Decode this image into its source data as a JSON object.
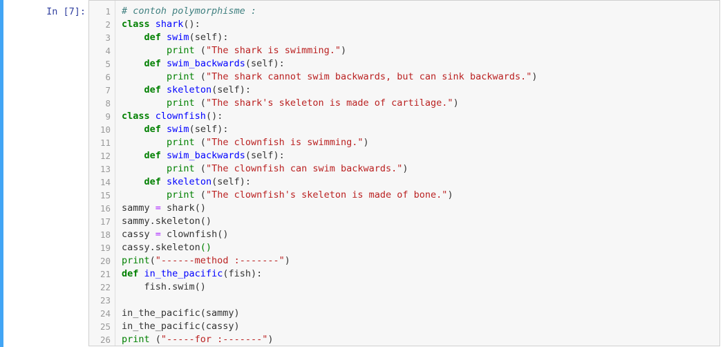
{
  "prompt": "In [7]:",
  "colors": {
    "cell_bar": "#42a5f5",
    "prompt": "#303f9f",
    "keyword": "#008000",
    "function_name": "#0000ff",
    "string": "#ba2121",
    "comment": "#408080",
    "operator": "#aa22ff"
  },
  "code_lines": [
    {
      "num": "1",
      "tokens": [
        {
          "t": "c",
          "v": "# contoh polymorphisme :"
        }
      ]
    },
    {
      "num": "2",
      "tokens": [
        {
          "t": "k",
          "v": "class"
        },
        {
          "t": "p",
          "v": " "
        },
        {
          "t": "nc",
          "v": "shark"
        },
        {
          "t": "p",
          "v": "():"
        }
      ]
    },
    {
      "num": "3",
      "tokens": [
        {
          "t": "p",
          "v": "    "
        },
        {
          "t": "k",
          "v": "def"
        },
        {
          "t": "p",
          "v": " "
        },
        {
          "t": "nf",
          "v": "swim"
        },
        {
          "t": "p",
          "v": "(self):"
        }
      ]
    },
    {
      "num": "4",
      "tokens": [
        {
          "t": "p",
          "v": "        "
        },
        {
          "t": "bi",
          "v": "print"
        },
        {
          "t": "p",
          "v": " ("
        },
        {
          "t": "s",
          "v": "\"The shark is swimming.\""
        },
        {
          "t": "p",
          "v": ")"
        }
      ]
    },
    {
      "num": "5",
      "tokens": [
        {
          "t": "p",
          "v": "    "
        },
        {
          "t": "k",
          "v": "def"
        },
        {
          "t": "p",
          "v": " "
        },
        {
          "t": "nf",
          "v": "swim_backwards"
        },
        {
          "t": "p",
          "v": "(self):"
        }
      ]
    },
    {
      "num": "6",
      "tokens": [
        {
          "t": "p",
          "v": "        "
        },
        {
          "t": "bi",
          "v": "print"
        },
        {
          "t": "p",
          "v": " ("
        },
        {
          "t": "s",
          "v": "\"The shark cannot swim backwards, but can sink backwards.\""
        },
        {
          "t": "p",
          "v": ")"
        }
      ]
    },
    {
      "num": "7",
      "tokens": [
        {
          "t": "p",
          "v": "    "
        },
        {
          "t": "k",
          "v": "def"
        },
        {
          "t": "p",
          "v": " "
        },
        {
          "t": "nf",
          "v": "skeleton"
        },
        {
          "t": "p",
          "v": "(self):"
        }
      ]
    },
    {
      "num": "8",
      "tokens": [
        {
          "t": "p",
          "v": "        "
        },
        {
          "t": "bi",
          "v": "print"
        },
        {
          "t": "p",
          "v": " ("
        },
        {
          "t": "s",
          "v": "\"The shark's skeleton is made of cartilage.\""
        },
        {
          "t": "p",
          "v": ")"
        }
      ]
    },
    {
      "num": "9",
      "tokens": [
        {
          "t": "k",
          "v": "class"
        },
        {
          "t": "p",
          "v": " "
        },
        {
          "t": "nc",
          "v": "clownfish"
        },
        {
          "t": "p",
          "v": "():"
        }
      ]
    },
    {
      "num": "10",
      "tokens": [
        {
          "t": "p",
          "v": "    "
        },
        {
          "t": "k",
          "v": "def"
        },
        {
          "t": "p",
          "v": " "
        },
        {
          "t": "nf",
          "v": "swim"
        },
        {
          "t": "p",
          "v": "(self):"
        }
      ]
    },
    {
      "num": "11",
      "tokens": [
        {
          "t": "p",
          "v": "        "
        },
        {
          "t": "bi",
          "v": "print"
        },
        {
          "t": "p",
          "v": " ("
        },
        {
          "t": "s",
          "v": "\"The clownfish is swimming.\""
        },
        {
          "t": "p",
          "v": ")"
        }
      ]
    },
    {
      "num": "12",
      "tokens": [
        {
          "t": "p",
          "v": "    "
        },
        {
          "t": "k",
          "v": "def"
        },
        {
          "t": "p",
          "v": " "
        },
        {
          "t": "nf",
          "v": "swim_backwards"
        },
        {
          "t": "p",
          "v": "(self):"
        }
      ]
    },
    {
      "num": "13",
      "tokens": [
        {
          "t": "p",
          "v": "        "
        },
        {
          "t": "bi",
          "v": "print"
        },
        {
          "t": "p",
          "v": " ("
        },
        {
          "t": "s",
          "v": "\"The clownfish can swim backwards.\""
        },
        {
          "t": "p",
          "v": ")"
        }
      ]
    },
    {
      "num": "14",
      "tokens": [
        {
          "t": "p",
          "v": "    "
        },
        {
          "t": "k",
          "v": "def"
        },
        {
          "t": "p",
          "v": " "
        },
        {
          "t": "nf",
          "v": "skeleton"
        },
        {
          "t": "p",
          "v": "(self):"
        }
      ]
    },
    {
      "num": "15",
      "tokens": [
        {
          "t": "p",
          "v": "        "
        },
        {
          "t": "bi",
          "v": "print"
        },
        {
          "t": "p",
          "v": " ("
        },
        {
          "t": "s",
          "v": "\"The clownfish's skeleton is made of bone.\""
        },
        {
          "t": "p",
          "v": ")"
        }
      ]
    },
    {
      "num": "16",
      "tokens": [
        {
          "t": "p",
          "v": "sammy "
        },
        {
          "t": "o",
          "v": "="
        },
        {
          "t": "p",
          "v": " shark()"
        }
      ]
    },
    {
      "num": "17",
      "tokens": [
        {
          "t": "p",
          "v": "sammy.skeleton()"
        }
      ]
    },
    {
      "num": "18",
      "tokens": [
        {
          "t": "p",
          "v": "cassy "
        },
        {
          "t": "o",
          "v": "="
        },
        {
          "t": "p",
          "v": " clownfish()"
        }
      ]
    },
    {
      "num": "19",
      "tokens": [
        {
          "t": "p",
          "v": "cassy.skeleton"
        },
        {
          "t": "mb",
          "v": "()"
        }
      ]
    },
    {
      "num": "20",
      "tokens": [
        {
          "t": "bi",
          "v": "print"
        },
        {
          "t": "p",
          "v": "("
        },
        {
          "t": "s",
          "v": "\"------method :-------\""
        },
        {
          "t": "p",
          "v": ")"
        }
      ]
    },
    {
      "num": "21",
      "tokens": [
        {
          "t": "k",
          "v": "def"
        },
        {
          "t": "p",
          "v": " "
        },
        {
          "t": "nf",
          "v": "in_the_pacific"
        },
        {
          "t": "p",
          "v": "(fish):"
        }
      ]
    },
    {
      "num": "22",
      "tokens": [
        {
          "t": "p",
          "v": "    fish.swim()"
        }
      ]
    },
    {
      "num": "23",
      "tokens": []
    },
    {
      "num": "24",
      "tokens": [
        {
          "t": "p",
          "v": "in_the_pacific(sammy)"
        }
      ]
    },
    {
      "num": "25",
      "tokens": [
        {
          "t": "p",
          "v": "in_the_pacific(cassy)"
        }
      ]
    },
    {
      "num": "26",
      "tokens": [
        {
          "t": "bi",
          "v": "print"
        },
        {
          "t": "p",
          "v": " ("
        },
        {
          "t": "s",
          "v": "\"-----for :-------\""
        },
        {
          "t": "p",
          "v": ")"
        }
      ]
    }
  ]
}
